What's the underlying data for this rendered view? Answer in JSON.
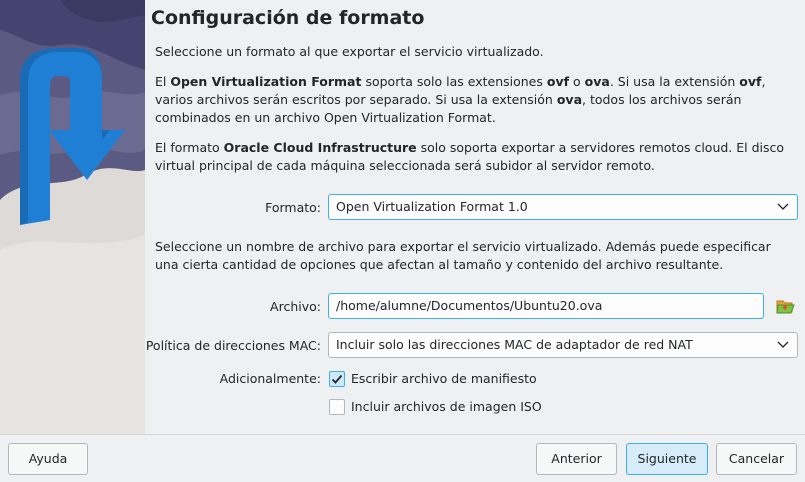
{
  "title": "Configuración de formato",
  "intro": "Seleccione un formato al que exportar el servicio virtualizado.",
  "ovf_para": {
    "t1": "El ",
    "b1": "Open Virtualization Format",
    "t2": " soporta solo las extensiones ",
    "b2": "ovf",
    "t3": " o ",
    "b3": "ova",
    "t4": ". Si usa la extensión ",
    "b4": "ovf",
    "t5": ", varios archivos serán escritos por separado. Si usa la extensión ",
    "b5": "ova",
    "t6": ", todos los archivos serán combinados en un archivo Open Virtualization Format."
  },
  "oci_para": {
    "t1": "El formato ",
    "b1": "Oracle Cloud Infrastructure",
    "t2": " solo soporta exportar a servidores remotos cloud. El disco virtual principal de cada máquina seleccionada será subidor al servidor remoto."
  },
  "format": {
    "label": "Formato:",
    "value": "Open Virtualization Format 1.0"
  },
  "file_intro": "Seleccione un nombre de archivo para exportar el servicio virtualizado. Además puede especificar una cierta cantidad de opciones que afectan al tamaño y contenido del archivo resultante.",
  "file": {
    "label": "Archivo:",
    "value": "/home/alumne/Documentos/Ubuntu20.ova"
  },
  "mac": {
    "label": "Política de direcciones MAC:",
    "value": "Incluir solo las direcciones MAC de adaptador de red NAT"
  },
  "additional": {
    "label": "Adicionalmente:",
    "manifest": {
      "label": "Escribir archivo de manifiesto",
      "checked": true
    },
    "iso": {
      "label": "Incluir archivos de imagen ISO",
      "checked": false
    }
  },
  "buttons": {
    "help": "Ayuda",
    "back": "Anterior",
    "next": "Siguiente",
    "cancel": "Cancelar"
  },
  "icons": {
    "dropdown": "chevron-down-icon",
    "folder": "folder-open-icon",
    "check": "checkmark-icon",
    "arrow": "export-arrow-icon"
  },
  "colors": {
    "accent": "#3daee9",
    "arrow": "#1f7fd4",
    "background": "#eff0f1"
  }
}
